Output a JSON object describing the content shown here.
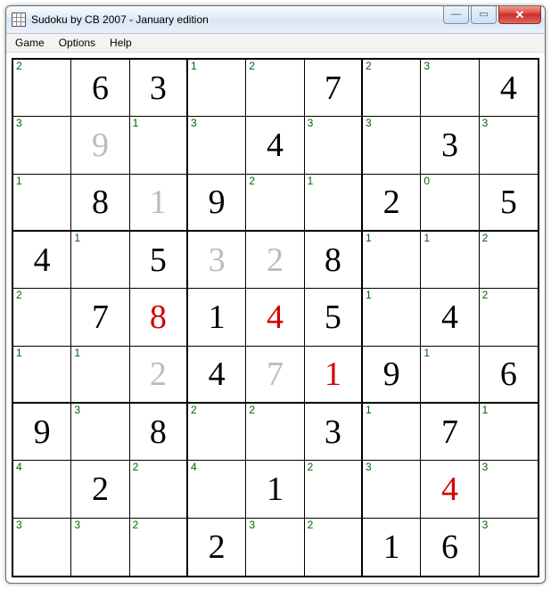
{
  "window": {
    "title": "Sudoku by CB 2007 - January edition"
  },
  "menu": {
    "items": [
      "Game",
      "Options",
      "Help"
    ]
  },
  "win_buttons": {
    "min": "—",
    "max": "▭",
    "close": "✕"
  },
  "board": {
    "rows": [
      [
        {
          "hint": "2",
          "value": null,
          "color": null
        },
        {
          "hint": null,
          "value": "6",
          "color": "black"
        },
        {
          "hint": null,
          "value": "3",
          "color": "black"
        },
        {
          "hint": "1",
          "value": null,
          "color": null
        },
        {
          "hint": "2",
          "value": null,
          "color": null
        },
        {
          "hint": null,
          "value": "7",
          "color": "black"
        },
        {
          "hint": "2",
          "value": null,
          "color": null
        },
        {
          "hint": "3",
          "value": null,
          "color": null
        },
        {
          "hint": null,
          "value": "4",
          "color": "black"
        }
      ],
      [
        {
          "hint": "3",
          "value": null,
          "color": null
        },
        {
          "hint": null,
          "value": "9",
          "color": "gray"
        },
        {
          "hint": "1",
          "value": null,
          "color": null
        },
        {
          "hint": "3",
          "value": null,
          "color": null
        },
        {
          "hint": null,
          "value": "4",
          "color": "black"
        },
        {
          "hint": "3",
          "value": null,
          "color": null
        },
        {
          "hint": "3",
          "value": null,
          "color": null
        },
        {
          "hint": null,
          "value": "3",
          "color": "black"
        },
        {
          "hint": "3",
          "value": null,
          "color": null
        }
      ],
      [
        {
          "hint": "1",
          "value": null,
          "color": null
        },
        {
          "hint": null,
          "value": "8",
          "color": "black"
        },
        {
          "hint": null,
          "value": "1",
          "color": "gray"
        },
        {
          "hint": null,
          "value": "9",
          "color": "black"
        },
        {
          "hint": "2",
          "value": null,
          "color": null
        },
        {
          "hint": "1",
          "value": null,
          "color": null
        },
        {
          "hint": null,
          "value": "2",
          "color": "black"
        },
        {
          "hint": "0",
          "value": null,
          "color": null
        },
        {
          "hint": null,
          "value": "5",
          "color": "black"
        }
      ],
      [
        {
          "hint": null,
          "value": "4",
          "color": "black"
        },
        {
          "hint": "1",
          "value": null,
          "color": null
        },
        {
          "hint": null,
          "value": "5",
          "color": "black"
        },
        {
          "hint": null,
          "value": "3",
          "color": "gray"
        },
        {
          "hint": null,
          "value": "2",
          "color": "gray"
        },
        {
          "hint": null,
          "value": "8",
          "color": "black"
        },
        {
          "hint": "1",
          "value": null,
          "color": null
        },
        {
          "hint": "1",
          "value": null,
          "color": null
        },
        {
          "hint": "2",
          "value": null,
          "color": null
        }
      ],
      [
        {
          "hint": "2",
          "value": null,
          "color": null
        },
        {
          "hint": null,
          "value": "7",
          "color": "black"
        },
        {
          "hint": null,
          "value": "8",
          "color": "red"
        },
        {
          "hint": null,
          "value": "1",
          "color": "black"
        },
        {
          "hint": null,
          "value": "4",
          "color": "red"
        },
        {
          "hint": null,
          "value": "5",
          "color": "black"
        },
        {
          "hint": "1",
          "value": null,
          "color": null
        },
        {
          "hint": null,
          "value": "4",
          "color": "black"
        },
        {
          "hint": "2",
          "value": null,
          "color": null
        }
      ],
      [
        {
          "hint": "1",
          "value": null,
          "color": null
        },
        {
          "hint": "1",
          "value": null,
          "color": null
        },
        {
          "hint": null,
          "value": "2",
          "color": "gray"
        },
        {
          "hint": null,
          "value": "4",
          "color": "black"
        },
        {
          "hint": null,
          "value": "7",
          "color": "gray"
        },
        {
          "hint": null,
          "value": "1",
          "color": "red"
        },
        {
          "hint": null,
          "value": "9",
          "color": "black"
        },
        {
          "hint": "1",
          "value": null,
          "color": null
        },
        {
          "hint": null,
          "value": "6",
          "color": "black"
        }
      ],
      [
        {
          "hint": null,
          "value": "9",
          "color": "black"
        },
        {
          "hint": "3",
          "value": null,
          "color": null
        },
        {
          "hint": null,
          "value": "8",
          "color": "black"
        },
        {
          "hint": "2",
          "value": null,
          "color": null
        },
        {
          "hint": "2",
          "value": null,
          "color": null
        },
        {
          "hint": null,
          "value": "3",
          "color": "black"
        },
        {
          "hint": "1",
          "value": null,
          "color": null
        },
        {
          "hint": null,
          "value": "7",
          "color": "black"
        },
        {
          "hint": "1",
          "value": null,
          "color": null
        }
      ],
      [
        {
          "hint": "4",
          "value": null,
          "color": null
        },
        {
          "hint": null,
          "value": "2",
          "color": "black"
        },
        {
          "hint": "2",
          "value": null,
          "color": null
        },
        {
          "hint": "4",
          "value": null,
          "color": null
        },
        {
          "hint": null,
          "value": "1",
          "color": "black"
        },
        {
          "hint": "2",
          "value": null,
          "color": null
        },
        {
          "hint": "3",
          "value": null,
          "color": null
        },
        {
          "hint": null,
          "value": "4",
          "color": "red"
        },
        {
          "hint": "3",
          "value": null,
          "color": null
        }
      ],
      [
        {
          "hint": "3",
          "value": null,
          "color": null
        },
        {
          "hint": "3",
          "value": null,
          "color": null
        },
        {
          "hint": "2",
          "value": null,
          "color": null
        },
        {
          "hint": null,
          "value": "2",
          "color": "black"
        },
        {
          "hint": "3",
          "value": null,
          "color": null
        },
        {
          "hint": "2",
          "value": null,
          "color": null
        },
        {
          "hint": null,
          "value": "1",
          "color": "black"
        },
        {
          "hint": null,
          "value": "6",
          "color": "black"
        },
        {
          "hint": "3",
          "value": null,
          "color": null
        }
      ]
    ]
  }
}
